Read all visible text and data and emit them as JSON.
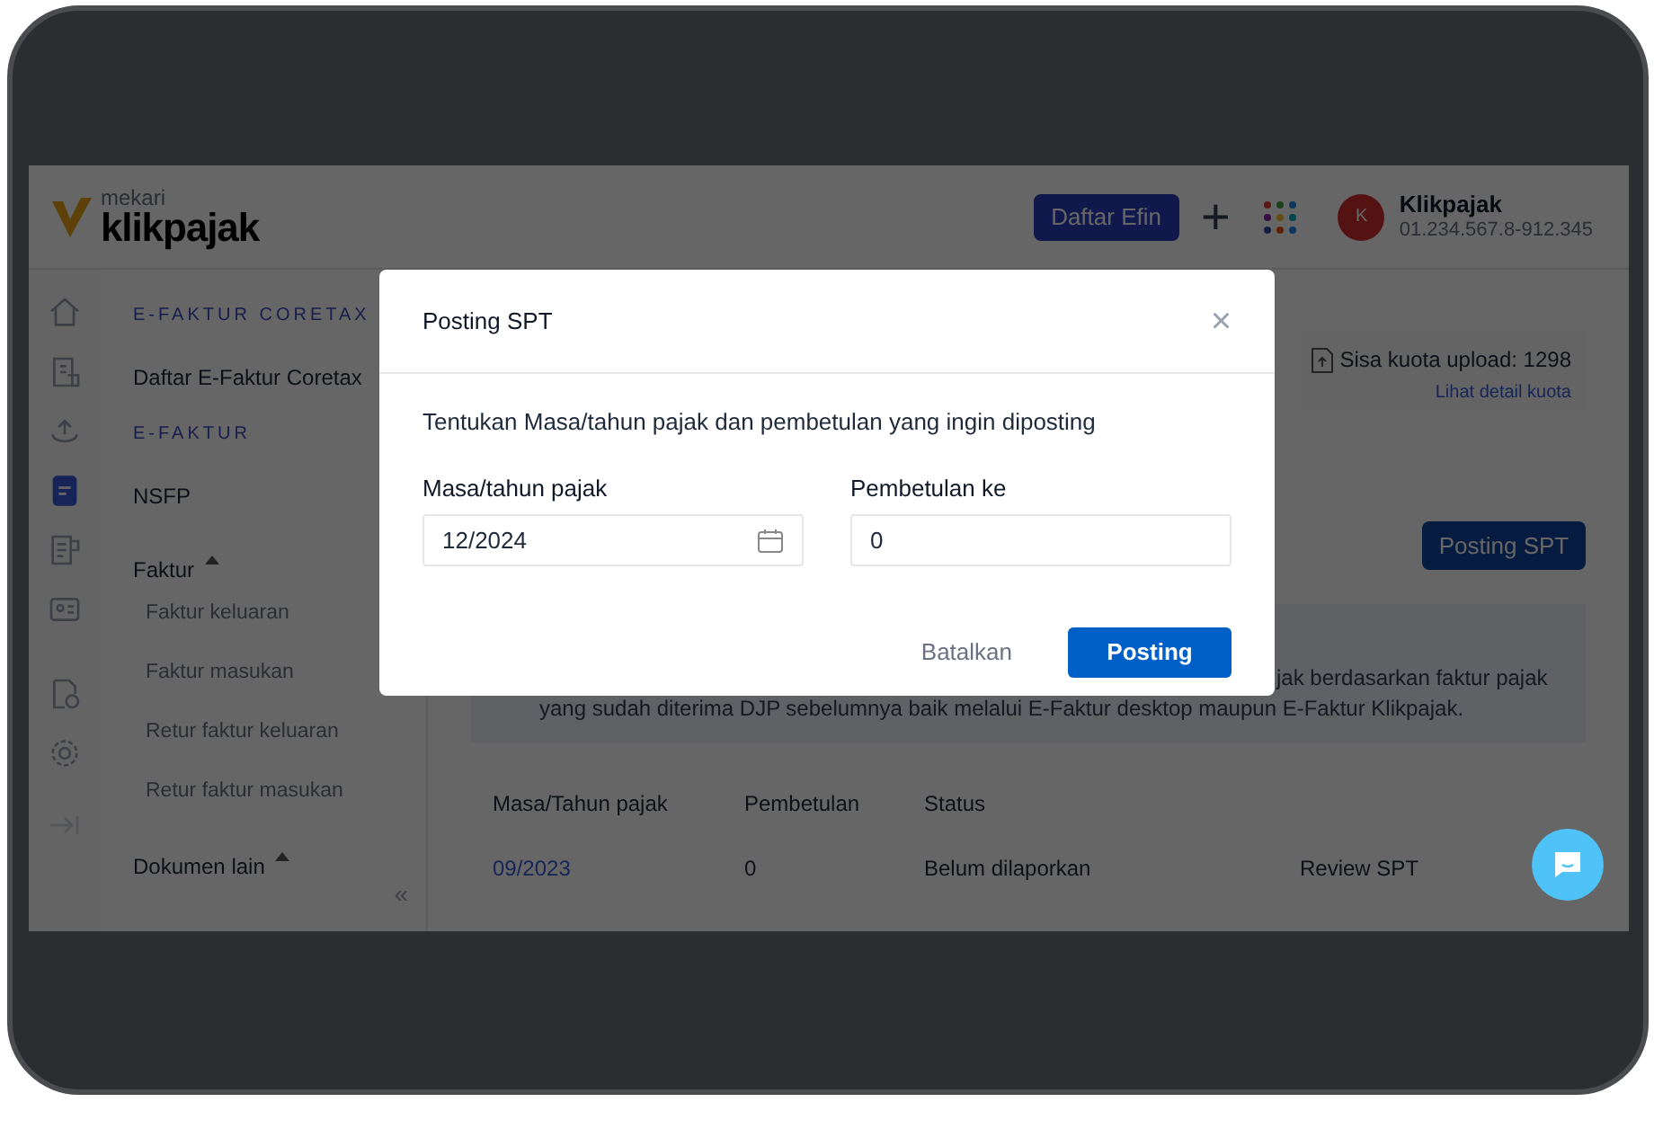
{
  "header": {
    "logo_small": "mekari",
    "logo": "klikpajak",
    "button": "Daftar Efin",
    "plus": "+",
    "avatar_initial": "K",
    "account_name": "Klikpajak",
    "account_id": "01.234.567.8-912.345"
  },
  "icon_rail": [
    {
      "kind": "home",
      "selected": false
    },
    {
      "kind": "receipt",
      "selected": false
    },
    {
      "kind": "upload",
      "selected": false
    },
    {
      "kind": "document",
      "selected": true
    },
    {
      "kind": "list",
      "selected": false
    },
    {
      "kind": "card",
      "selected": false
    },
    {
      "kind": "check",
      "selected": false
    },
    {
      "kind": "settings",
      "selected": false
    }
  ],
  "sidebar": {
    "items": [
      {
        "kind": "section",
        "label": "E-FAKTUR CORETAX"
      },
      {
        "kind": "item",
        "label": "Daftar E-Faktur Coretax"
      },
      {
        "kind": "section",
        "label": "E-FAKTUR"
      },
      {
        "kind": "item",
        "label": "NSFP"
      },
      {
        "kind": "group",
        "label": "Faktur",
        "expanded": true,
        "children": [
          {
            "label": "Faktur keluaran"
          },
          {
            "label": "Faktur masukan"
          },
          {
            "label": "Retur faktur keluaran"
          },
          {
            "label": "Retur faktur masukan"
          }
        ]
      },
      {
        "kind": "group",
        "label": "Dokumen lain",
        "expanded": true
      }
    ],
    "collapse": "«"
  },
  "quota": {
    "text": "Sisa kuota upload: 1298",
    "link": "Lihat detail kuota"
  },
  "posting_button": "Posting SPT",
  "info": {
    "line_1": "jak berdasarkan faktur pajak",
    "line_2": "yang sudah diterima DJP sebelumnya baik melalui E-Faktur desktop maupun E-Faktur Klikpajak."
  },
  "table": {
    "columns": [
      "Masa/Tahun pajak",
      "Pembetulan",
      "Status"
    ],
    "rows": [
      {
        "period": "09/2023",
        "revision": "0",
        "status": "Belum dilaporkan",
        "action": "Review SPT"
      }
    ]
  },
  "dialog": {
    "title": "Posting SPT",
    "close": "×",
    "description": "Tentukan Masa/tahun pajak dan pembetulan yang ingin diposting",
    "fields": [
      {
        "label": "Masa/tahun pajak",
        "value": "12/2024",
        "kind": "date"
      },
      {
        "label": "Pembetulan ke",
        "value": "0",
        "kind": "text"
      }
    ],
    "cancel": "Batalkan",
    "confirm": "Posting"
  }
}
